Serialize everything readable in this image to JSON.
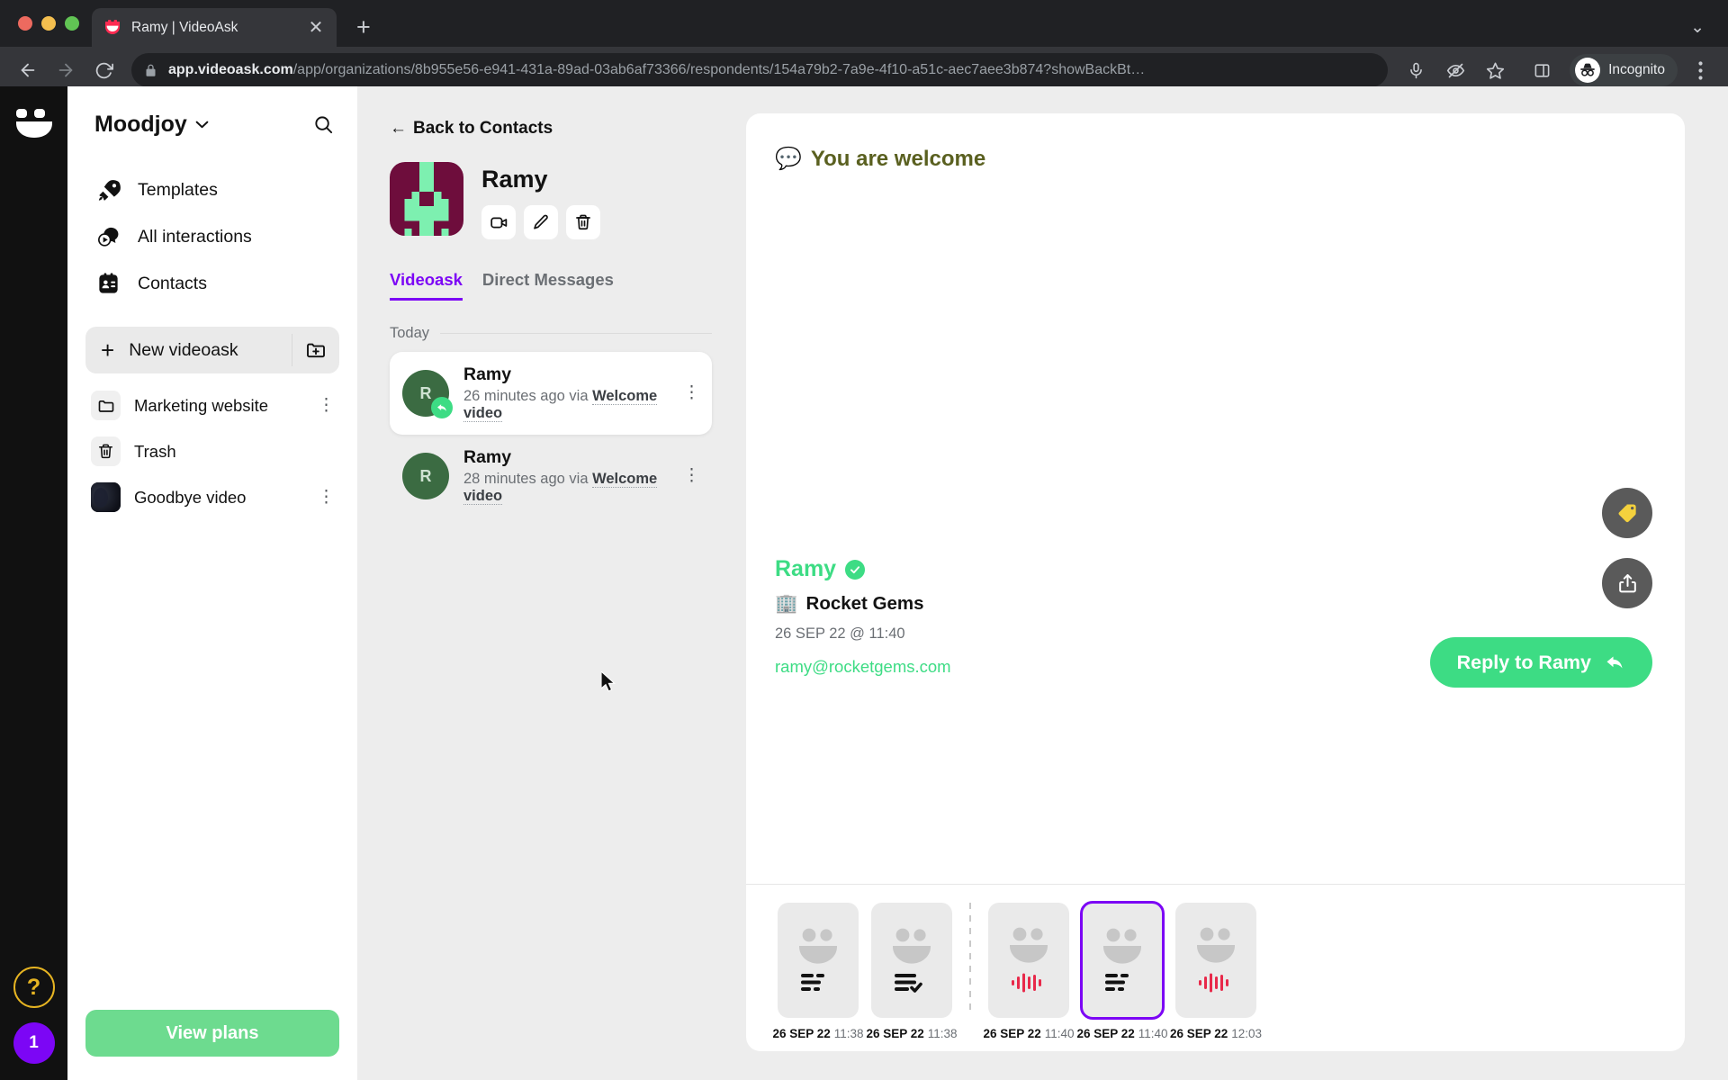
{
  "browser": {
    "tab": {
      "title": "Ramy | VideoAsk",
      "favicon": "videoask-smiley-icon",
      "close": "✕"
    },
    "new_tab_label": "+",
    "tab_list_chevron": "⌄",
    "url_bold": "app.videoask.com",
    "url_rest": "/app/organizations/8b955e56-e941-431a-89ad-03ab6af73366/respondents/154a79b2-7a9e-4f10-a51c-aec7aee3b874?showBackBt…",
    "profile_label": "Incognito",
    "icons": {
      "back": "back-arrow-icon",
      "forward": "forward-arrow-icon",
      "reload": "reload-icon",
      "lock": "lock-icon",
      "mic": "microphone-icon",
      "eye_off": "eye-off-icon",
      "star": "bookmark-star-icon",
      "sidepanel": "side-panel-icon",
      "menu": "browser-menu-icon"
    }
  },
  "rail": {
    "logo": "videoask-logo-icon",
    "help": "?",
    "count": "1"
  },
  "sidebar": {
    "org_name": "Moodjoy",
    "org_chevron": "⌄",
    "search_icon": "search-icon",
    "nav": [
      {
        "label": "Templates",
        "icon": "rocket-icon"
      },
      {
        "label": "All interactions",
        "icon": "play-bubble-icon"
      },
      {
        "label": "Contacts",
        "icon": "contacts-icon"
      }
    ],
    "new_videoask": {
      "label": "New videoask",
      "plus": "+",
      "folder_icon": "new-folder-icon"
    },
    "folders": [
      {
        "label": "Marketing website",
        "icon": "folder-icon",
        "kebab": "⋮",
        "dark": false
      },
      {
        "label": "Trash",
        "icon": "trash-icon",
        "kebab": "",
        "dark": false
      },
      {
        "label": "Goodbye video",
        "icon": "video-thumb-icon",
        "kebab": "⋮",
        "dark": true
      }
    ],
    "view_plans": "View plans"
  },
  "contacts": {
    "back_label": "Back to Contacts",
    "back_arrow": "←",
    "avatar": "identicon-avatar",
    "name": "Ramy",
    "actions": [
      {
        "name": "video-call-button",
        "icon": "video-camera-icon"
      },
      {
        "name": "edit-contact-button",
        "icon": "pencil-icon"
      },
      {
        "name": "delete-contact-button",
        "icon": "trash-icon"
      }
    ],
    "tabs": [
      {
        "label": "Videoask",
        "active": true
      },
      {
        "label": "Direct Messages",
        "active": false
      }
    ],
    "day_label": "Today",
    "responses": [
      {
        "initial": "R",
        "name": "Ramy",
        "time": "26 minutes ago via ",
        "via": "Welcome video",
        "selected": true,
        "badge": "reply-badge-icon",
        "kebab": "⋮"
      },
      {
        "initial": "R",
        "name": "Ramy",
        "time": "28 minutes ago via ",
        "via": "Welcome video",
        "selected": false,
        "badge": "",
        "kebab": "⋮"
      }
    ]
  },
  "main": {
    "title": "You are welcome",
    "title_emoji": "💬",
    "tag_button_icon": "tag-icon",
    "share_button_icon": "share-icon",
    "reply_button": {
      "label": "Reply to Ramy",
      "icon": "reply-arrow-icon"
    },
    "respondent": {
      "name": "Ramy",
      "verified_icon": "verified-check-icon",
      "org_emoji": "🏢",
      "org": "Rocket Gems",
      "date": "26 SEP 22 @ 11:40",
      "email": "ramy@rocketgems.com"
    },
    "strip": [
      {
        "type": "text",
        "date": "26 SEP 22",
        "time": "11:38",
        "active": false,
        "icon": "text-lines-icon"
      },
      {
        "type": "multiple-choice",
        "date": "26 SEP 22",
        "time": "11:38",
        "active": false,
        "icon": "checklist-icon"
      },
      {
        "type": "audio",
        "date": "26 SEP 22",
        "time": "11:40",
        "active": false,
        "icon": "audio-wave-icon"
      },
      {
        "type": "text",
        "date": "26 SEP 22",
        "time": "11:40",
        "active": true,
        "icon": "text-lines-icon"
      },
      {
        "type": "audio",
        "date": "26 SEP 22",
        "time": "12:03",
        "active": false,
        "icon": "audio-wave-icon"
      }
    ]
  },
  "colors": {
    "accent_purple": "#7c06f5",
    "accent_green": "#3ddc84",
    "plans_green": "#6ddb8f",
    "title_olive": "#5a6020",
    "audio_red": "#e8294a",
    "identicon_bg": "#6e0d3c",
    "identicon_fg": "#7df0b0"
  }
}
